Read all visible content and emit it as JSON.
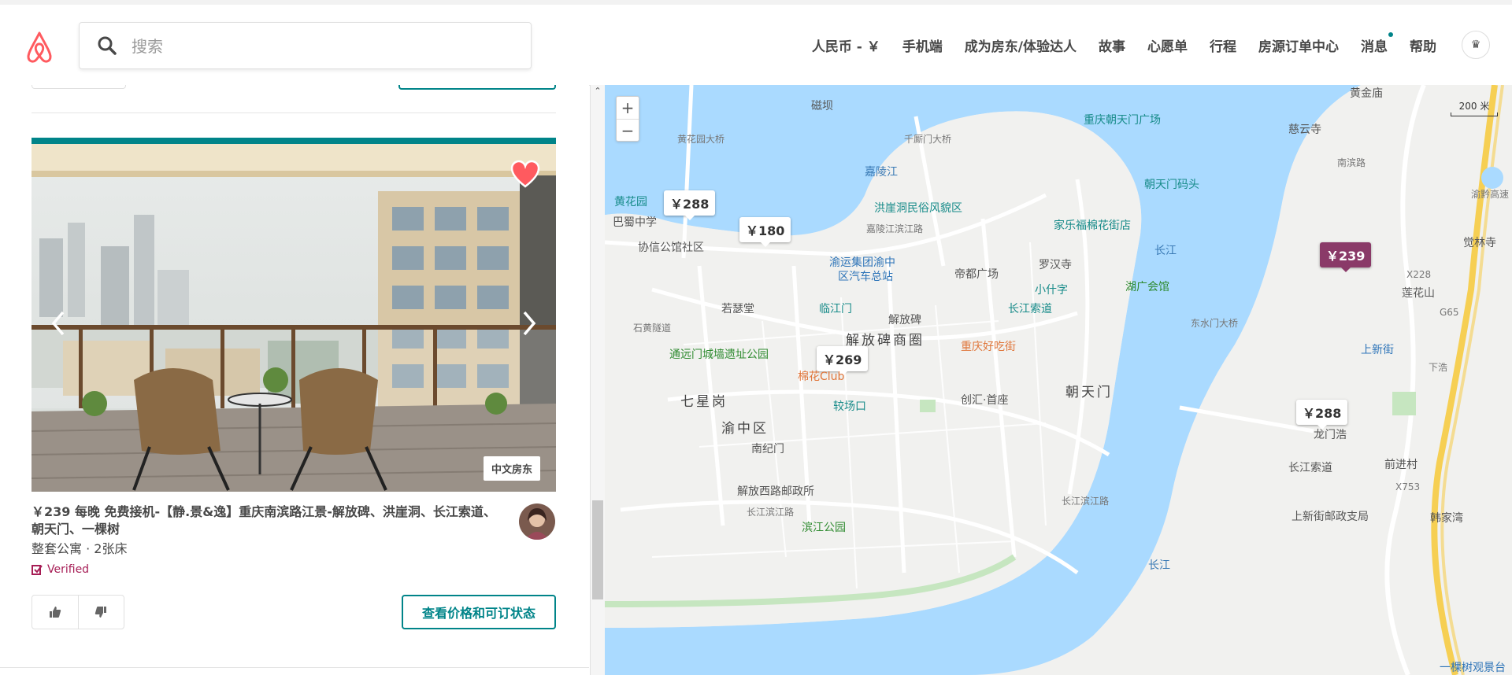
{
  "header": {
    "search_placeholder": "搜索",
    "nav": [
      "人民币 - ￥",
      "手机端",
      "成为房东/体验达人",
      "故事",
      "心愿单",
      "行程",
      "房源订单中心",
      "消息",
      "帮助"
    ],
    "avatar_glyph": "♛",
    "accent": "#ff5a5f"
  },
  "listing": {
    "badge": "中文房东",
    "title": "￥239 每晚 免费接机-【静.景&逸】重庆南滨路江景-解放碑、洪崖洞、长江索道、朝天门、一棵树",
    "subtitle": "整套公寓 · 2张床",
    "verified": "Verified",
    "cta": "查看价格和可订状态",
    "teal": "#008489",
    "verified_color": "#a61d55"
  },
  "map": {
    "zoom_in": "+",
    "zoom_out": "−",
    "scale": "200 米",
    "pins": [
      "￥288",
      "￥180",
      "￥269",
      "￥239",
      "￥288"
    ],
    "labels": {
      "l1": "磁坝",
      "l2": "黄花园",
      "l3": "巴蜀中学",
      "l4": "协信公馆社区",
      "l5": "嘉陵江",
      "l6": "洪崖洞民俗风貌区",
      "l7": "嘉陵江滨江路",
      "l8": "家乐福棉花街店",
      "l9": "重庆朝天门广场",
      "l10": "朝天门码头",
      "l11": "罗汉寺",
      "l12": "渝运集团渝中区汽车总站",
      "l13": "帝都广场",
      "l14": "小什字",
      "l15": "湖广会馆",
      "l16": "若瑟堂",
      "l17": "临江门",
      "l18": "解放碑",
      "l19": "长江索道",
      "l20": "解放碑商圈",
      "l21": "重庆好吃街",
      "l22": "通远门城墙遗址公园",
      "l23": "棉花Club",
      "l24": "较场口",
      "l25": "创汇·首座",
      "l26": "朝天门",
      "l27": "七星岗",
      "l28": "渝中区",
      "l29": "南纪门",
      "l30": "解放西路邮政所",
      "l31": "长江滨江路",
      "l32": "滨江公园",
      "l33": "长江",
      "l34": "长江",
      "l35": "黄金庙",
      "l36": "慈云寺",
      "l37": "觉林寺",
      "l38": "莲花山",
      "l39": "上新街",
      "l40": "龙门浩",
      "l41": "长江索道",
      "l42": "前进村",
      "l43": "上新街邮政支局",
      "l44": "韩家湾",
      "l45": "一棵树观景台",
      "l46": "东水门大桥",
      "l47": "千厮门大桥",
      "l48": "黄花园大桥",
      "l49": "G65",
      "l50": "X228",
      "l51": "X753",
      "l52": "长江滨江路",
      "l53": "下浩",
      "l54": "渝黔高速",
      "l55": "南滨路",
      "l56": "石黄隧道"
    }
  }
}
